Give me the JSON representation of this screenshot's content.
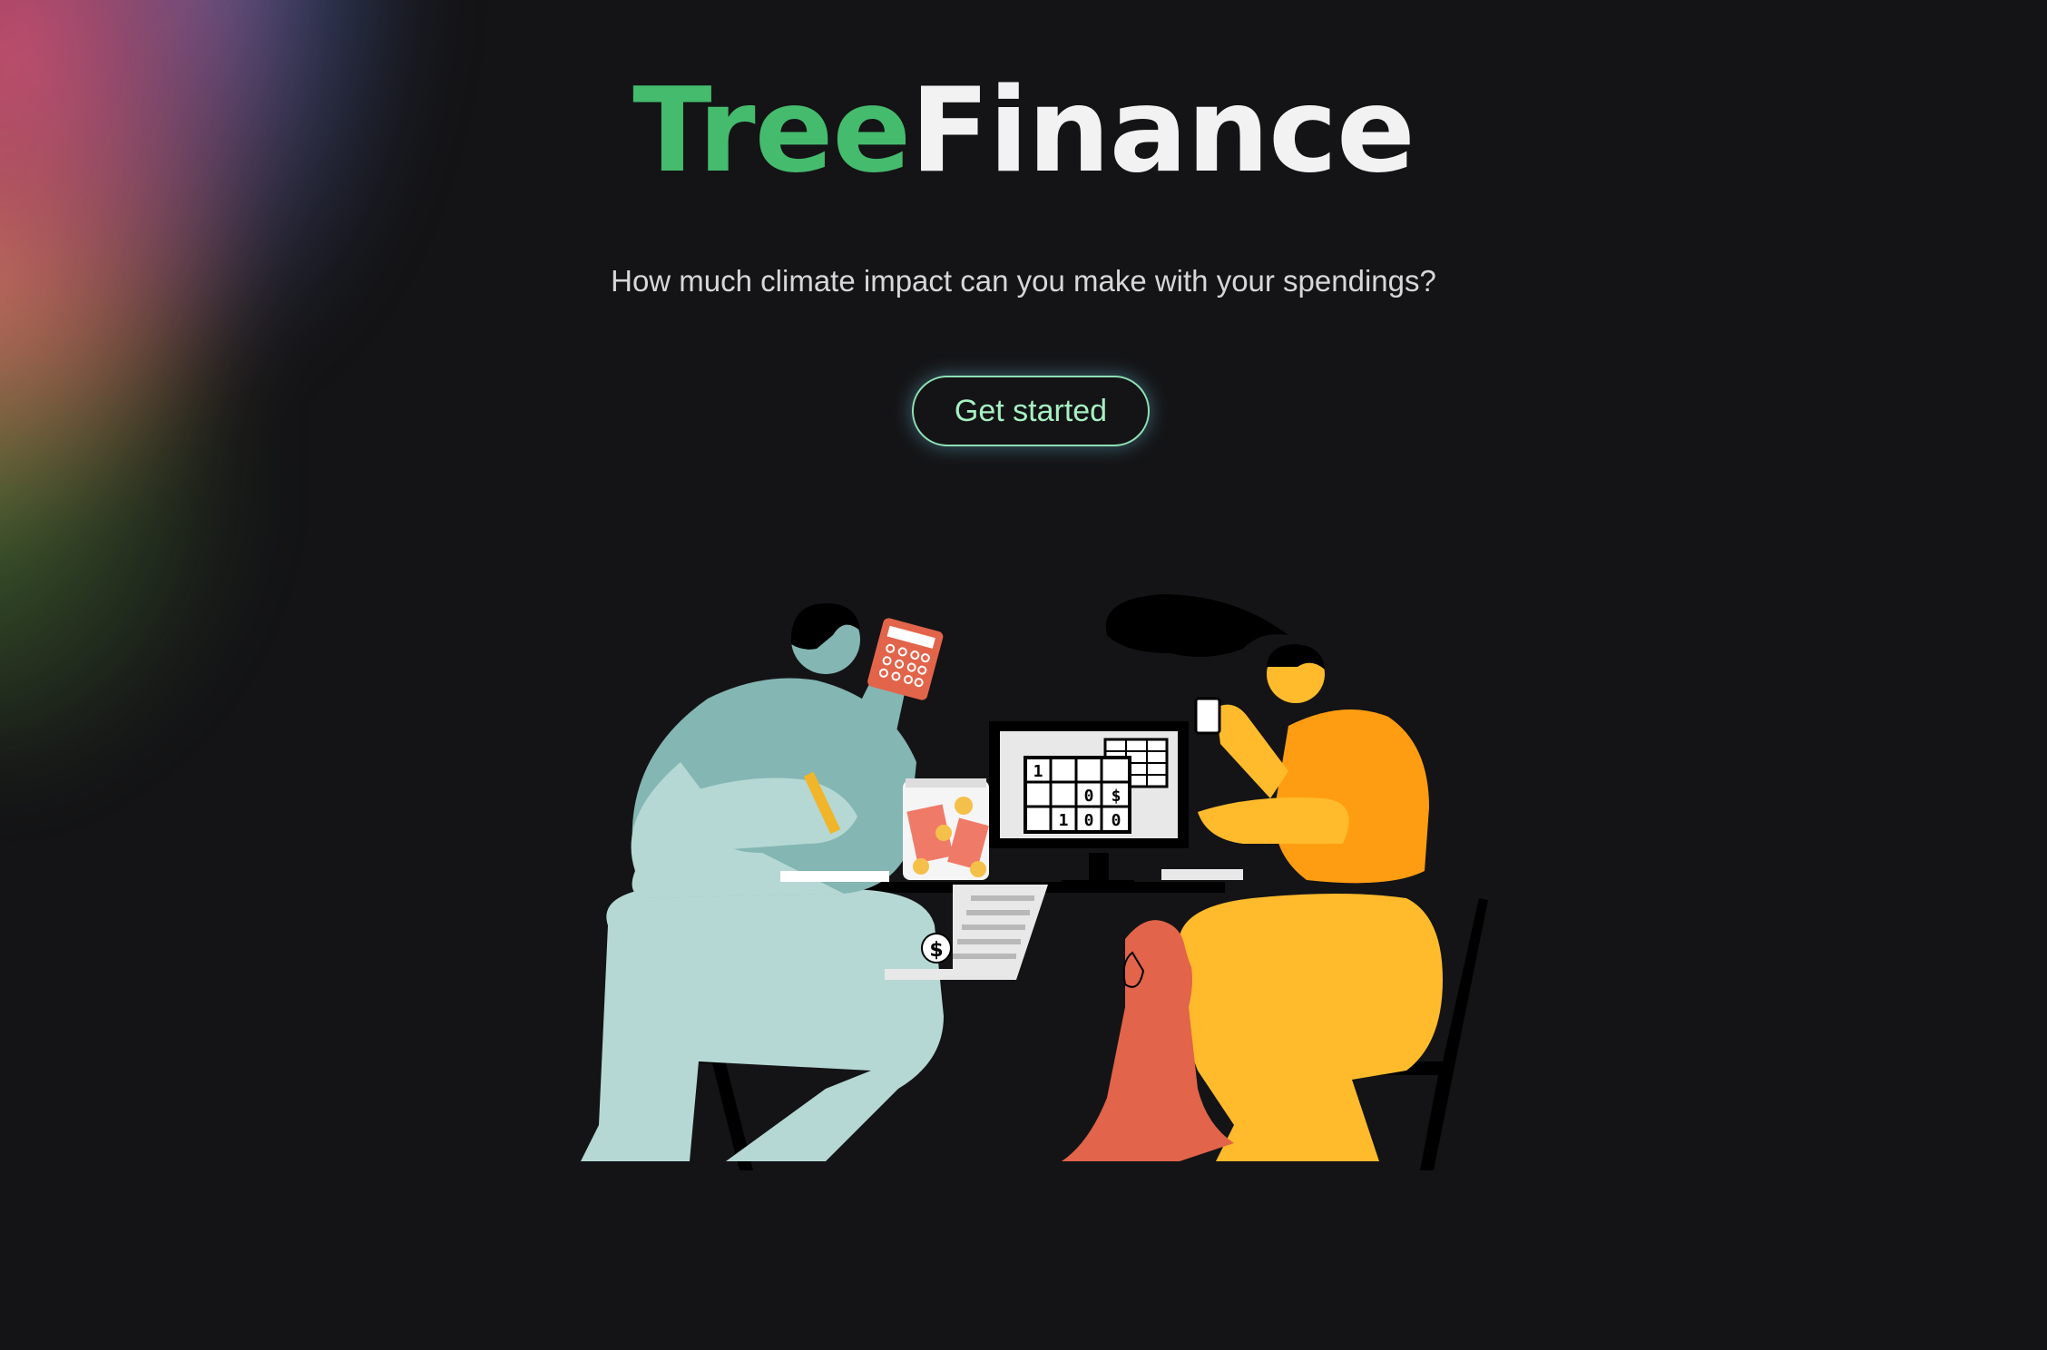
{
  "brand": {
    "title_part1": "Tree",
    "title_part2": "Finance",
    "accent_color": "#45bb6e"
  },
  "hero": {
    "subtitle": "How much climate impact can you make with your spendings?",
    "cta_label": "Get started"
  },
  "illustration": {
    "spreadsheet_cells": [
      "1",
      "0",
      "$",
      "1",
      "0",
      "0"
    ],
    "receipt_symbol": "$"
  }
}
